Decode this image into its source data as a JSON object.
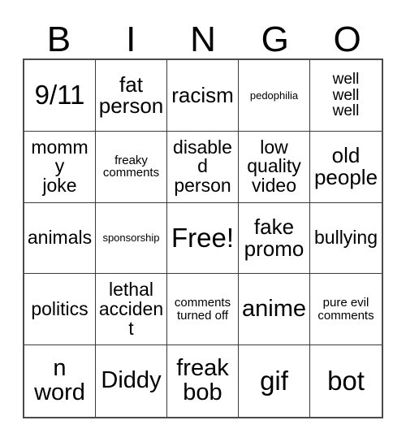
{
  "card": {
    "title": "Bingo Card",
    "header_letters": [
      "B",
      "I",
      "N",
      "G",
      "O"
    ],
    "colors": {
      "background": "#ffffff",
      "text": "#000000",
      "grid_line": "#3a3a3a",
      "grid_outer": "#4a4a4a"
    },
    "rows": [
      [
        {
          "text": "9/11",
          "size": "fs-xxl"
        },
        {
          "text": "fat\nperson",
          "size": "fs-l"
        },
        {
          "text": "racism",
          "size": "fs-l"
        },
        {
          "text": "pedophilia",
          "size": "fs-xxs"
        },
        {
          "text": "well\nwell\nwell",
          "size": "fs-s"
        }
      ],
      [
        {
          "text": "mommy\njoke",
          "size": "fs-m"
        },
        {
          "text": "freaky\ncomments",
          "size": "fs-xs"
        },
        {
          "text": "disabled\nperson",
          "size": "fs-m"
        },
        {
          "text": "low\nquality\nvideo",
          "size": "fs-m"
        },
        {
          "text": "old\npeople",
          "size": "fs-l"
        }
      ],
      [
        {
          "text": "animals",
          "size": "fs-m"
        },
        {
          "text": "sponsorship",
          "size": "fs-xxs"
        },
        {
          "text": "Free!",
          "size": "fs-xxl"
        },
        {
          "text": "fake\npromo",
          "size": "fs-l"
        },
        {
          "text": "bullying",
          "size": "fs-m"
        }
      ],
      [
        {
          "text": "politics",
          "size": "fs-m"
        },
        {
          "text": "lethal\naccident",
          "size": "fs-m"
        },
        {
          "text": "comments\nturned off",
          "size": "fs-xs"
        },
        {
          "text": "anime",
          "size": "fs-xl"
        },
        {
          "text": "pure evil\ncomments",
          "size": "fs-xs"
        }
      ],
      [
        {
          "text": "n\nword",
          "size": "fs-xl"
        },
        {
          "text": "Diddy",
          "size": "fs-xl"
        },
        {
          "text": "freak\nbob",
          "size": "fs-xl"
        },
        {
          "text": "gif",
          "size": "fs-xxl"
        },
        {
          "text": "bot",
          "size": "fs-xxl"
        }
      ]
    ]
  }
}
